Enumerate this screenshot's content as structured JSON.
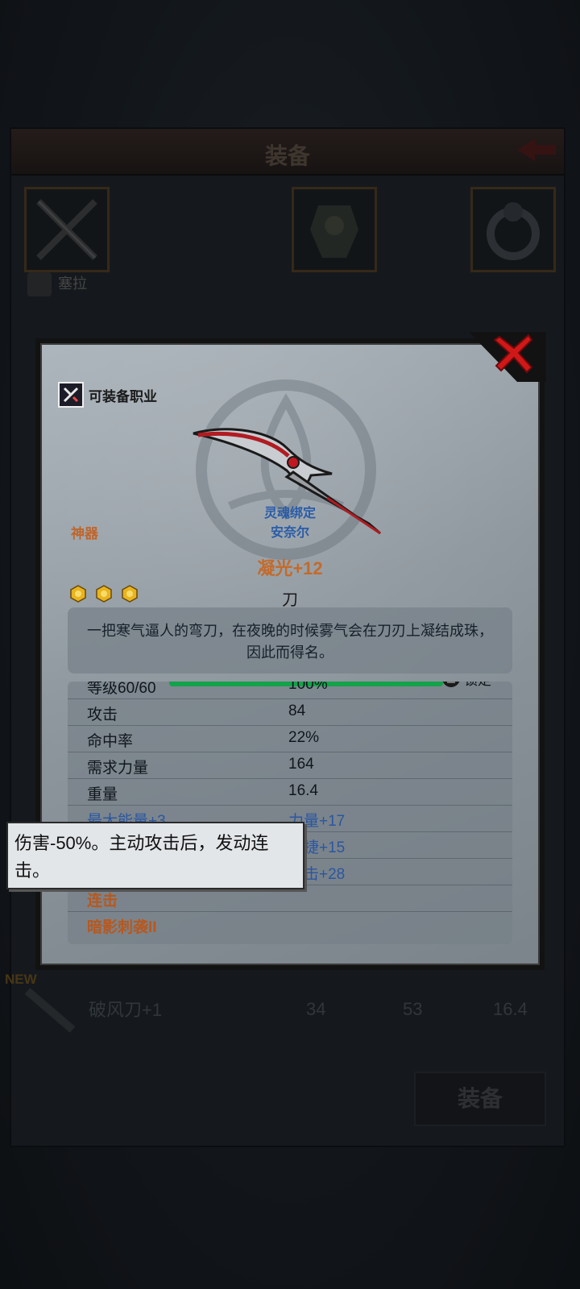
{
  "background": {
    "title": "装备",
    "character_name": "塞拉",
    "new_tag": "NEW",
    "list_item": {
      "name": "破风刀+1",
      "attack": "34",
      "accuracy": "53",
      "weight": "16.4"
    },
    "equip_button": "装备"
  },
  "dialog": {
    "job_label": "可装备职业",
    "rarity": "神器",
    "bound_status": "灵魂绑定",
    "bound_owner": "安奈尔",
    "item_name": "凝光+12",
    "item_type": "刀",
    "description": "一把寒气逼人的弯刀，在夜晚的时候雾气会在刀刃上凝结成珠，因此而得名。",
    "star_count": 3,
    "stats": {
      "level_label": "等级60/60",
      "level_percent": "100%",
      "lock_label": "锁定",
      "rows": [
        {
          "key": "攻击",
          "value": "84"
        },
        {
          "key": "命中率",
          "value": "22%"
        },
        {
          "key": "需求力量",
          "value": "164"
        },
        {
          "key": "重量",
          "value": "16.4"
        }
      ],
      "bonus_left": "最大能量+3",
      "bonus_right_1": "力量+17",
      "bonus_right_2": "敏捷+15",
      "bonus_right_3": "暴击+28",
      "skill_1": "连击",
      "skill_2": "暗影刺袭II"
    }
  },
  "tooltip": {
    "text": "伤害-50%。主动攻击后，发动连击。"
  },
  "colors": {
    "orange": "#c46a2a",
    "blue": "#2a56a0",
    "bar": "#14a24a",
    "close": "#d01818"
  }
}
